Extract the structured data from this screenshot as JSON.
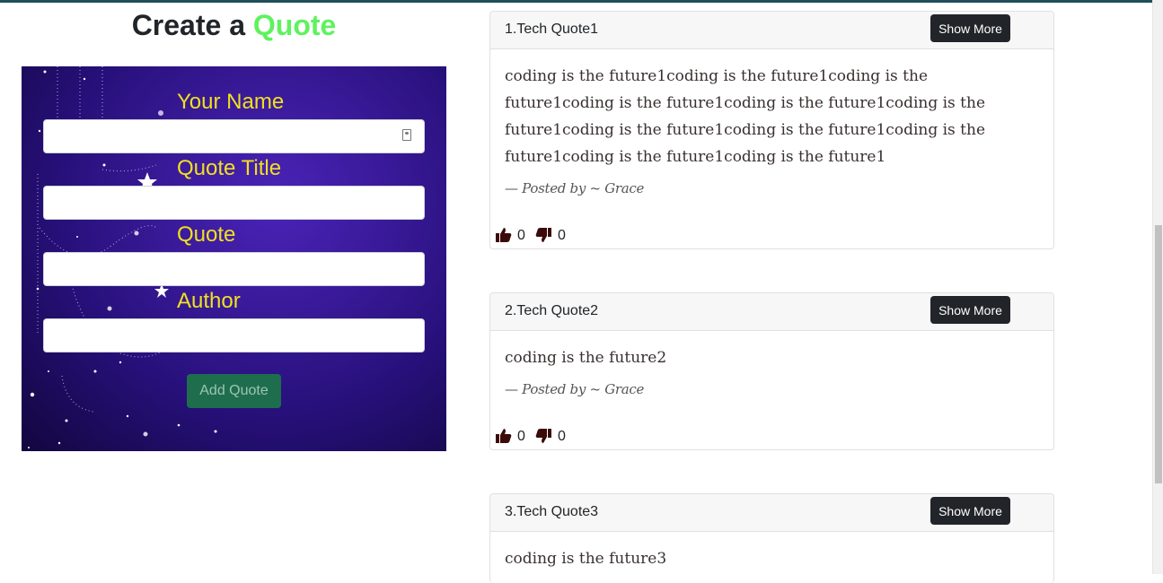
{
  "form": {
    "title_prefix": "Create a",
    "title_accent": "Quote",
    "name_label": "Your Name",
    "title_label": "Quote Title",
    "quote_label": "Quote",
    "author_label": "Author",
    "submit_label": "Add Quote"
  },
  "quotes": [
    {
      "title": "1.Tech Quote1",
      "text": "coding is the future1coding is the future1coding is the future1coding is the future1coding is the future1coding is the future1coding is the future1coding is the future1coding is the future1coding is the future1coding is the future1",
      "posted": "— Posted by ~ Grace",
      "likes": "0",
      "dislikes": "0",
      "show_more": "Show More"
    },
    {
      "title": "2.Tech Quote2",
      "text": "coding is the future2",
      "posted": "— Posted by ~ Grace",
      "likes": "0",
      "dislikes": "0",
      "show_more": "Show More"
    },
    {
      "title": "3.Tech Quote3",
      "text": "coding is the future3",
      "show_more": "Show More"
    }
  ],
  "colors": {
    "accent": "#5ef25e",
    "label": "#f0e020",
    "button_dark": "#212529",
    "button_green": "#1e6e4e",
    "vote_icon": "#3d0a0a"
  }
}
